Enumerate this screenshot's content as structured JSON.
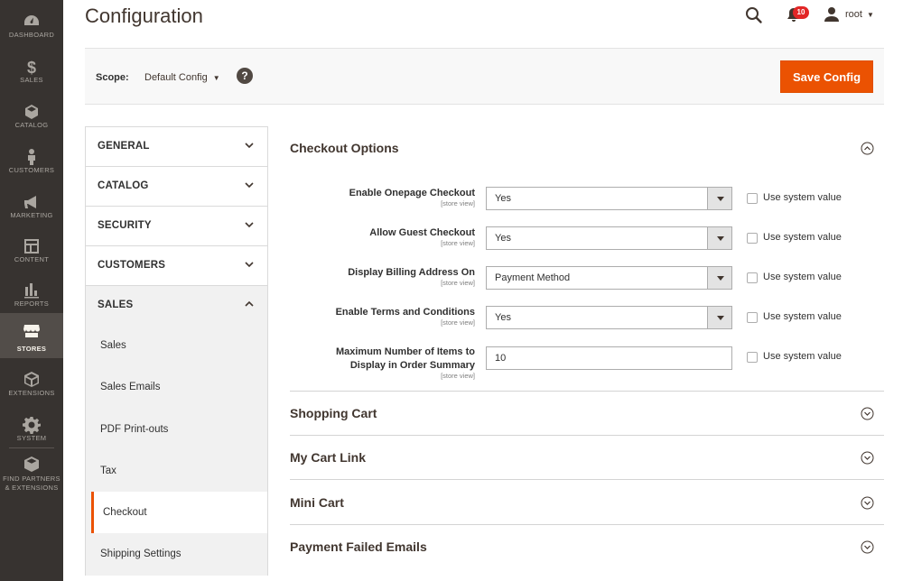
{
  "menu": {
    "items": [
      {
        "label": "DASHBOARD",
        "icon": "dashboard-icon"
      },
      {
        "label": "SALES",
        "icon": "dollar-icon"
      },
      {
        "label": "CATALOG",
        "icon": "cube-icon"
      },
      {
        "label": "CUSTOMERS",
        "icon": "person-icon"
      },
      {
        "label": "MARKETING",
        "icon": "megaphone-icon"
      },
      {
        "label": "CONTENT",
        "icon": "layout-icon"
      },
      {
        "label": "REPORTS",
        "icon": "bar-chart-icon"
      },
      {
        "label": "STORES",
        "icon": "storefront-icon",
        "active": true
      },
      {
        "label": "EXTENSIONS",
        "icon": "boxes-icon"
      },
      {
        "label": "SYSTEM",
        "icon": "gear-icon"
      },
      {
        "label": "FIND PARTNERS\n& EXTENSIONS",
        "label_line1": "FIND PARTNERS",
        "label_line2": "& EXTENSIONS",
        "icon": "partners-box-icon"
      }
    ]
  },
  "header": {
    "title": "Configuration",
    "notifications_count": "10",
    "user": "root"
  },
  "scope": {
    "label": "Scope:",
    "value": "Default Config",
    "help": "?",
    "save_label": "Save Config"
  },
  "tabs": {
    "groups": [
      "GENERAL",
      "CATALOG",
      "SECURITY",
      "CUSTOMERS",
      "SALES"
    ],
    "sales_items": [
      "Sales",
      "Sales Emails",
      "PDF Print-outs",
      "Tax",
      "Checkout",
      "Shipping Settings"
    ],
    "active_item": "Checkout"
  },
  "checkout_options": {
    "title": "Checkout Options",
    "use_system_value": "Use system value",
    "rows": [
      {
        "label": "Enable Onepage Checkout",
        "scope": "[store view]",
        "value": "Yes"
      },
      {
        "label": "Allow Guest Checkout",
        "scope": "[store view]",
        "value": "Yes"
      },
      {
        "label": "Display Billing Address On",
        "scope": "[store view]",
        "value": "Payment Method"
      },
      {
        "label": "Enable Terms and Conditions",
        "scope": "[store view]",
        "value": "Yes"
      },
      {
        "label_line1": "Maximum Number of Items to",
        "label_line2": "Display in Order Summary",
        "scope": "[store view]",
        "value": "10"
      }
    ]
  },
  "sections": [
    "Shopping Cart",
    "My Cart Link",
    "Mini Cart",
    "Payment Failed Emails"
  ],
  "colors": {
    "accent": "#eb5202",
    "menu_bg": "#373330",
    "menu_active": "#524d49",
    "badge": "#e22626"
  }
}
